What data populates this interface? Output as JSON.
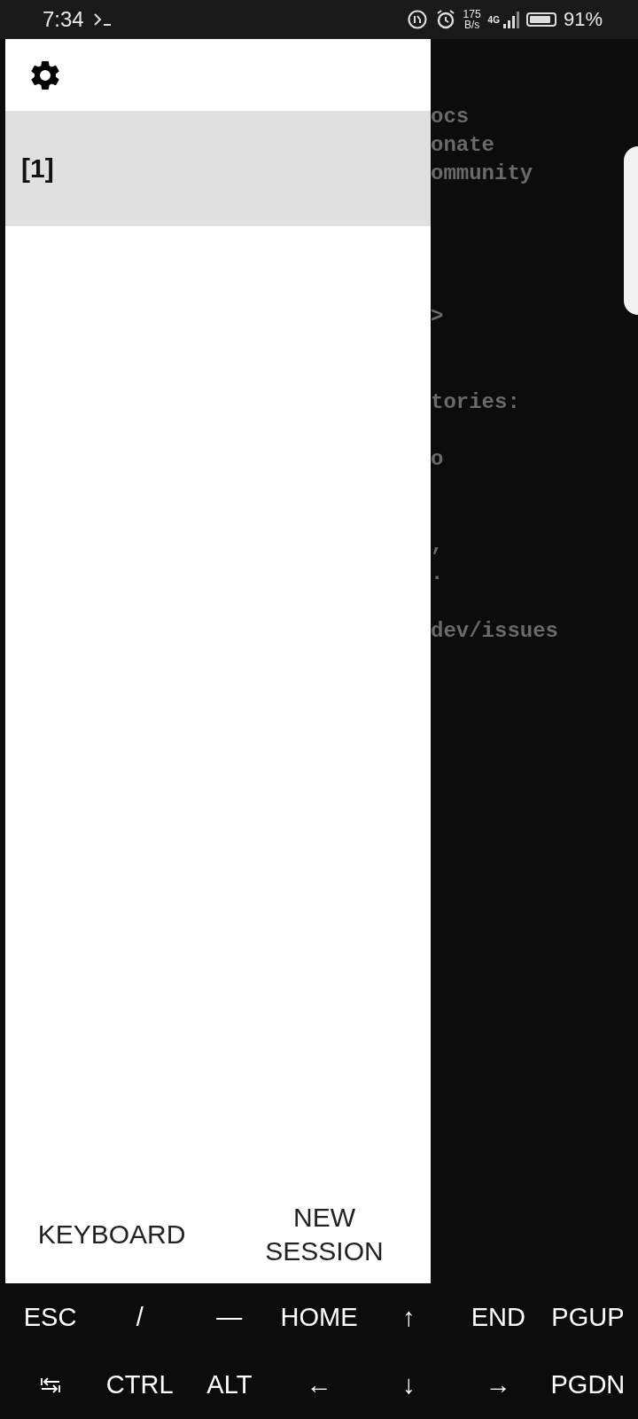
{
  "status_bar": {
    "time": "7:34",
    "net_speed": "175",
    "net_unit": "B/s",
    "network_type": "4G",
    "battery_percent": "91%"
  },
  "drawer": {
    "sessions": [
      {
        "label": "[1]",
        "selected": true
      }
    ],
    "buttons": [
      "KEYBOARD",
      "NEW SESSION"
    ]
  },
  "terminal": {
    "text": "ocs\nonate\nommunity\n\n\n\n\n>\n\n\ntories:\n\no\n\n\n,\n.\n\ndev/issues"
  },
  "extra_keys": [
    {
      "kind": "text",
      "label": "ESC"
    },
    {
      "kind": "text",
      "label": "/"
    },
    {
      "kind": "text",
      "label": "—"
    },
    {
      "kind": "text",
      "label": "HOME"
    },
    {
      "kind": "text",
      "label": "↑"
    },
    {
      "kind": "text",
      "label": "END"
    },
    {
      "kind": "text",
      "label": "PGUP"
    },
    {
      "kind": "tab"
    },
    {
      "kind": "text",
      "label": "CTRL"
    },
    {
      "kind": "text",
      "label": "ALT"
    },
    {
      "kind": "text",
      "label": "←"
    },
    {
      "kind": "text",
      "label": "↓"
    },
    {
      "kind": "text",
      "label": "→"
    },
    {
      "kind": "text",
      "label": "PGDN"
    }
  ]
}
